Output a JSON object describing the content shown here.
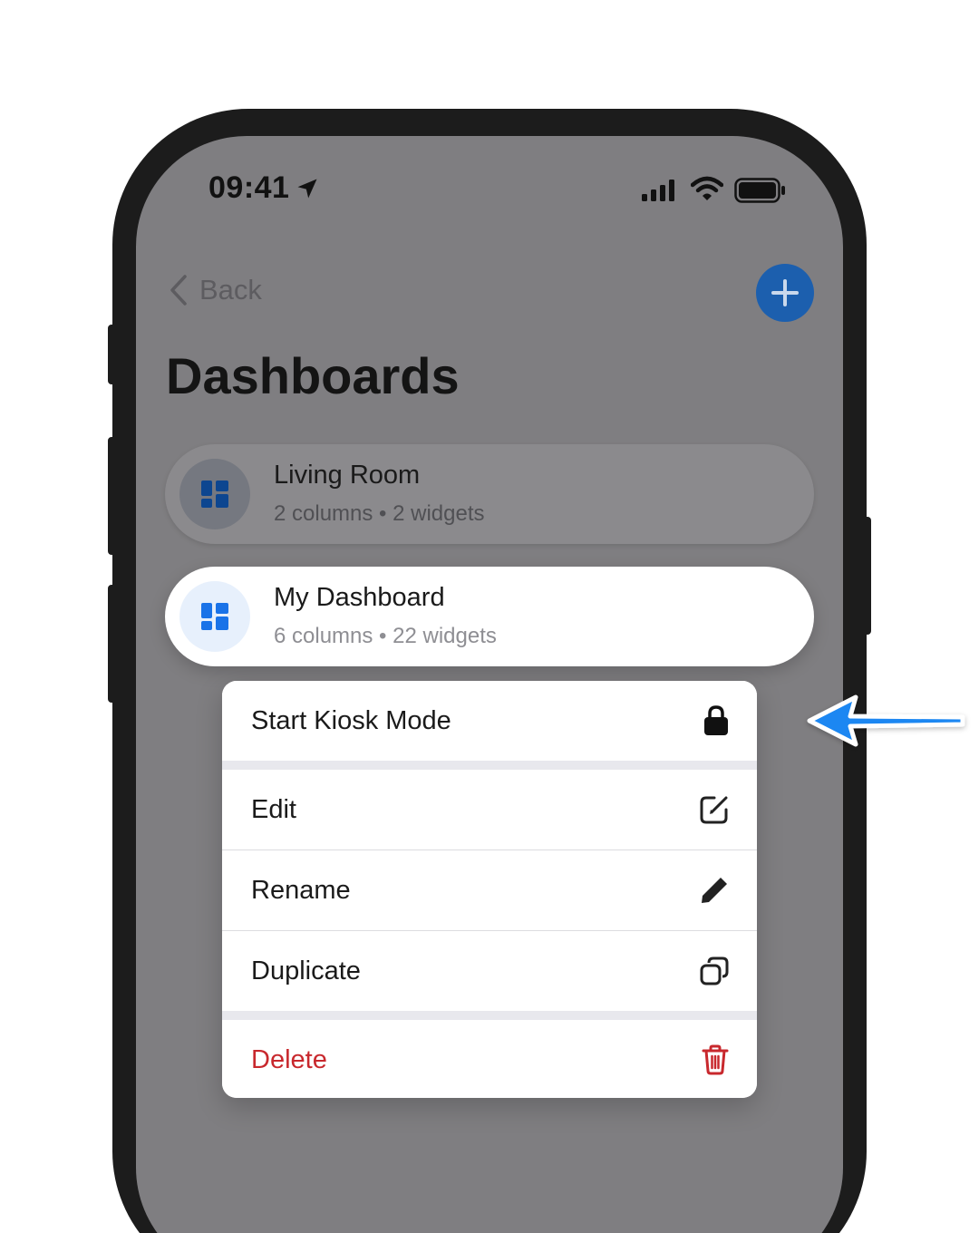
{
  "status_bar": {
    "time": "09:41",
    "icons": [
      "location-arrow-icon",
      "signal-icon",
      "wifi-icon",
      "battery-icon"
    ]
  },
  "nav": {
    "back_label": "Back",
    "add_icon": "plus-icon"
  },
  "page": {
    "title": "Dashboards"
  },
  "dashboards": [
    {
      "title": "Living Room",
      "subtitle": "2 columns • 2 widgets",
      "icon": "dashboard-icon"
    },
    {
      "title": "My Dashboard",
      "subtitle": "6 columns • 22 widgets",
      "icon": "dashboard-icon"
    }
  ],
  "context_menu": {
    "items": [
      {
        "label": "Start Kiosk Mode",
        "icon": "lock-icon"
      },
      {
        "label": "Edit",
        "icon": "edit-icon"
      },
      {
        "label": "Rename",
        "icon": "pencil-icon"
      },
      {
        "label": "Duplicate",
        "icon": "duplicate-icon"
      },
      {
        "label": "Delete",
        "icon": "trash-icon"
      }
    ]
  },
  "colors": {
    "accent": "#1a73e8",
    "destructive": "#c8282d",
    "dim_overlay": "#7f7e81",
    "pointer_arrow": "#1a87f2"
  }
}
